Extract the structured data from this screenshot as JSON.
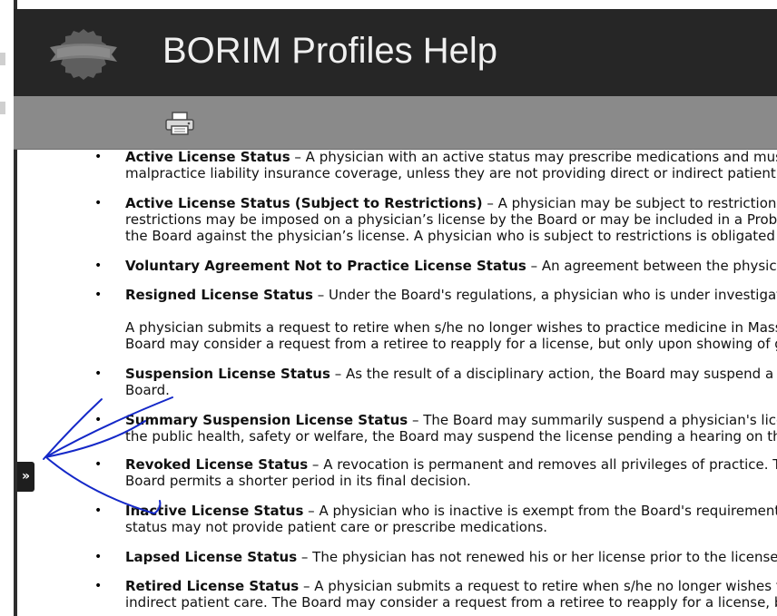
{
  "header": {
    "title": "BORIM Profiles Help",
    "logo_icon": "ribbon-seal-icon",
    "toolbar_print_icon": "printer-icon"
  },
  "sidebar": {
    "expand_label": "»"
  },
  "colors": {
    "header_bg": "#262626",
    "toolbar_bg": "#8a8a8a",
    "annotation_ink": "#1428c8"
  },
  "statuses": [
    {
      "term": "Active License Status",
      "lines": [
        " – A physician with an active status may prescribe medications and must",
        "malpractice liability insurance coverage, unless they are not providing direct or indirect patient ca"
      ]
    },
    {
      "term": "Active License Status (Subject to Restrictions)",
      "lines": [
        " – A physician may be subject to restrictions",
        "restrictions may be imposed on a physician’s license by the Board or may be included in a Probat",
        "the Board against the physician’s license. A physician who is subject to restrictions is obligated to"
      ]
    },
    {
      "term": "Voluntary Agreement Not to Practice License Status",
      "lines": [
        " – An agreement between the physiciar"
      ]
    },
    {
      "term": "Resigned License Status",
      "lines": [
        " – Under the Board's regulations, a physician who is under investigatic"
      ],
      "extra": [
        "A physician submits a request to retire when s/he no longer wishes to practice medicine in Massa",
        "Board may consider a request from a retiree to reapply for a license, but only upon showing of go"
      ]
    },
    {
      "term": "Suspension License Status",
      "lines": [
        " – As the result of a disciplinary action, the Board may suspend a ph",
        "Board."
      ]
    },
    {
      "term": "Summary Suspension License Status",
      "lines": [
        " – The Board may summarily suspend a physician's licen",
        "the public health, safety or welfare, the Board may suspend the license pending a hearing on the"
      ]
    },
    {
      "term": "Revoked License Status",
      "lines": [
        " – A revocation is permanent and removes all privileges of practice. Th",
        "Board permits a shorter period in its final decision."
      ]
    },
    {
      "term": "Inactive License Status",
      "lines": [
        " – A physician who is inactive is exempt from the Board's requirements",
        "status may not provide patient care or prescribe medications."
      ]
    },
    {
      "term": "Lapsed License Status",
      "lines": [
        " – The physician has not renewed his or her license prior to the license e"
      ]
    },
    {
      "term": "Retired License Status",
      "lines": [
        " – A physician submits a request to retire when s/he no longer wishes to",
        "indirect patient care. The Board may consider a request from a retiree to reapply for a license, bu"
      ]
    }
  ]
}
